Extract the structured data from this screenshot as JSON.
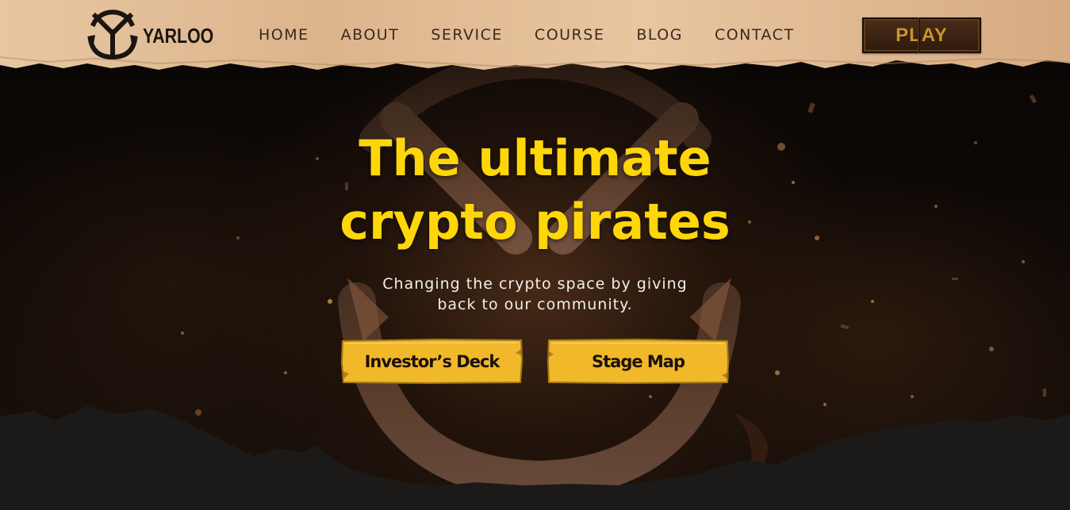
{
  "brand": {
    "name": "YARLOO"
  },
  "nav": {
    "items": [
      {
        "label": "HOME"
      },
      {
        "label": "ABOUT"
      },
      {
        "label": "SERVICE"
      },
      {
        "label": "COURSE"
      },
      {
        "label": "BLOG"
      },
      {
        "label": "CONTACT"
      }
    ]
  },
  "header": {
    "play_label": "PLAY"
  },
  "hero": {
    "title_line1": "The ultimate",
    "title_line2": "crypto pirates",
    "subtitle_line1": "Changing the crypto space by giving",
    "subtitle_line2": "back to our community.",
    "primary_cta": "Investor’s Deck",
    "secondary_cta": "Stage Map"
  },
  "colors": {
    "accent_yellow": "#ffd60a",
    "button_yellow": "#f1b82a",
    "paper": "#e6c29b",
    "play_button": "#3a2314",
    "play_text": "#c9962e"
  },
  "icons": {
    "logo": "anchor-y-logo-icon",
    "background": "anchor-icon"
  }
}
